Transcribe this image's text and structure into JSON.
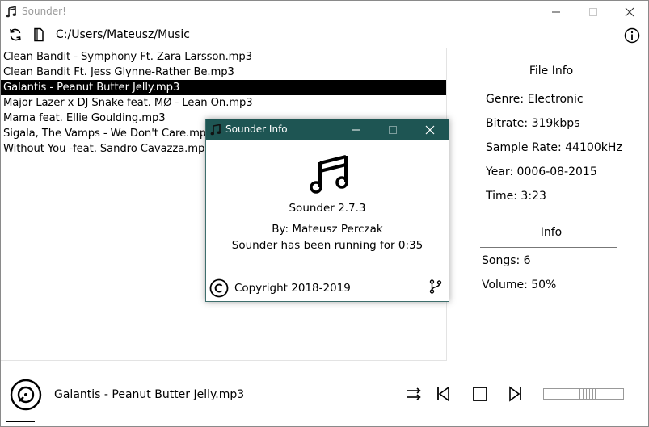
{
  "window": {
    "title": "Sounder!"
  },
  "toolbar": {
    "path": "C:/Users/Mateusz/Music",
    "icons": [
      "refresh-icon",
      "file-icon",
      "info-icon"
    ]
  },
  "songs": [
    "Clean Bandit - Symphony Ft. Zara Larsson.mp3",
    "Clean Bandit Ft. Jess Glynne-Rather Be.mp3",
    "Galantis - Peanut Butter Jelly.mp3",
    "Major Lazer x DJ Snake feat. MØ - Lean On.mp3",
    "Mama feat. Ellie Goulding.mp3",
    "Sigala, The Vamps - We Don't Care.mp3",
    "Without You -feat. Sandro Cavazza.mp3"
  ],
  "selected_index": 2,
  "file_info": {
    "heading": "File Info",
    "genre": "Genre: Electronic",
    "bitrate": "Bitrate: 319kbps",
    "sample_rate": "Sample Rate: 44100kHz",
    "year": "Year: 0006-08-2015",
    "time": "Time: 3:23"
  },
  "info": {
    "heading": "Info",
    "songs": "Songs: 6",
    "volume": "Volume: 50%"
  },
  "player": {
    "now_playing": "Galantis - Peanut Butter Jelly.mp3",
    "volume_fraction": 0.5,
    "controls": [
      "shuffle-icon",
      "previous-icon",
      "stop-icon",
      "next-icon"
    ]
  },
  "dialog": {
    "title": "Sounder Info",
    "version": "Sounder 2.7.3",
    "author": "By: Mateusz Perczak",
    "uptime": "Sounder has been running for 0:35",
    "copyright": "Copyright 2018-2019"
  },
  "colors": {
    "dialog_titlebar": "#1e5553",
    "selection": "#000000",
    "title_gray": "#9a9a9a"
  }
}
